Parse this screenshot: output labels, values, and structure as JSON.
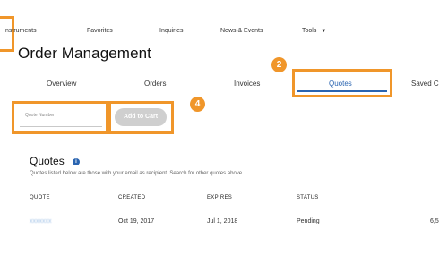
{
  "nav": {
    "items": [
      "nstruments",
      "Favorites",
      "Inquiries",
      "News & Events",
      "Tools"
    ]
  },
  "page_title": "Order Management",
  "tabs": {
    "overview": "Overview",
    "orders": "Orders",
    "invoices": "Invoices",
    "quotes": "Quotes",
    "saved": "Saved C"
  },
  "search": {
    "placeholder": "Quote Number",
    "add_to_cart_label": "Add to Cart"
  },
  "badges": {
    "quotes_step": "2",
    "add_to_cart_step": "4"
  },
  "quotes": {
    "title": "Quotes",
    "info_icon_glyph": "i",
    "subtitle": "Quotes listed below are those with your email as recipient. Search for other quotes above.",
    "columns": [
      "QUOTE",
      "CREATED",
      "EXPIRES",
      "STATUS"
    ],
    "rows": [
      {
        "quote": "xxxxxxx",
        "created": "Oct 19, 2017",
        "expires": "Jul 1, 2018",
        "status": "Pending",
        "amount": "6,5"
      }
    ]
  },
  "colors": {
    "highlight": "#f0962a",
    "accent": "#2a64b0",
    "button_disabled": "#cfcfcf"
  }
}
